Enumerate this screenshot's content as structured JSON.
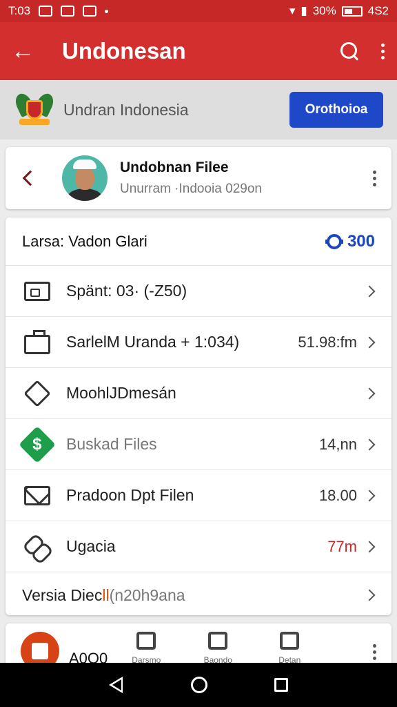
{
  "status": {
    "time": "T:03",
    "battery": "30%",
    "network": "4S2"
  },
  "appbar": {
    "title": "Undonesan",
    "back_icon": "arrow-back-icon",
    "search_icon": "search-icon",
    "menu_icon": "more-vert-icon"
  },
  "banner": {
    "name": "Undran Indonesia",
    "button_label": "Orothoioa",
    "button_color": "#1e48c8"
  },
  "profile": {
    "name": "Undobnan Filee",
    "subtitle": "Unurram ·Indooia 029on"
  },
  "list": {
    "header_title": "Larsa: Vadon Glari",
    "header_value": "300",
    "rows": [
      {
        "icon": "id-card-icon",
        "label": "Spänt: 03· (‑Z50)",
        "value": ""
      },
      {
        "icon": "briefcase-icon",
        "label": "SarlelM Uranda + 1:034)",
        "value": "51.98:fm"
      },
      {
        "icon": "tag-icon",
        "label_main": "Moohl",
        "label_accent": "",
        "label_rest": "JDmesán",
        "value": ""
      },
      {
        "icon": "dollar-icon",
        "label": "Buskad Files",
        "value": "14,nn"
      },
      {
        "icon": "mail-icon",
        "label": "Pradoon Dpt Filen",
        "value": "18.00"
      },
      {
        "icon": "link-icon",
        "label": "Ugacia",
        "value": "77m"
      },
      {
        "icon": "",
        "label_main": "Versia Diec",
        "label_accent": "ll",
        "label_rest": "(n20h9ana",
        "value": ""
      }
    ]
  },
  "bottom": {
    "label": "A0O0",
    "tabs": [
      {
        "icon": "robot-icon",
        "label": "Darsmo"
      },
      {
        "icon": "document-icon",
        "label": "Baondo"
      },
      {
        "icon": "square-icon",
        "label": "Detan"
      }
    ]
  },
  "colors": {
    "primary": "#d32f2f",
    "status_bar": "#c62828",
    "accent_blue": "#1a47c0",
    "value_red": "#c62828"
  }
}
